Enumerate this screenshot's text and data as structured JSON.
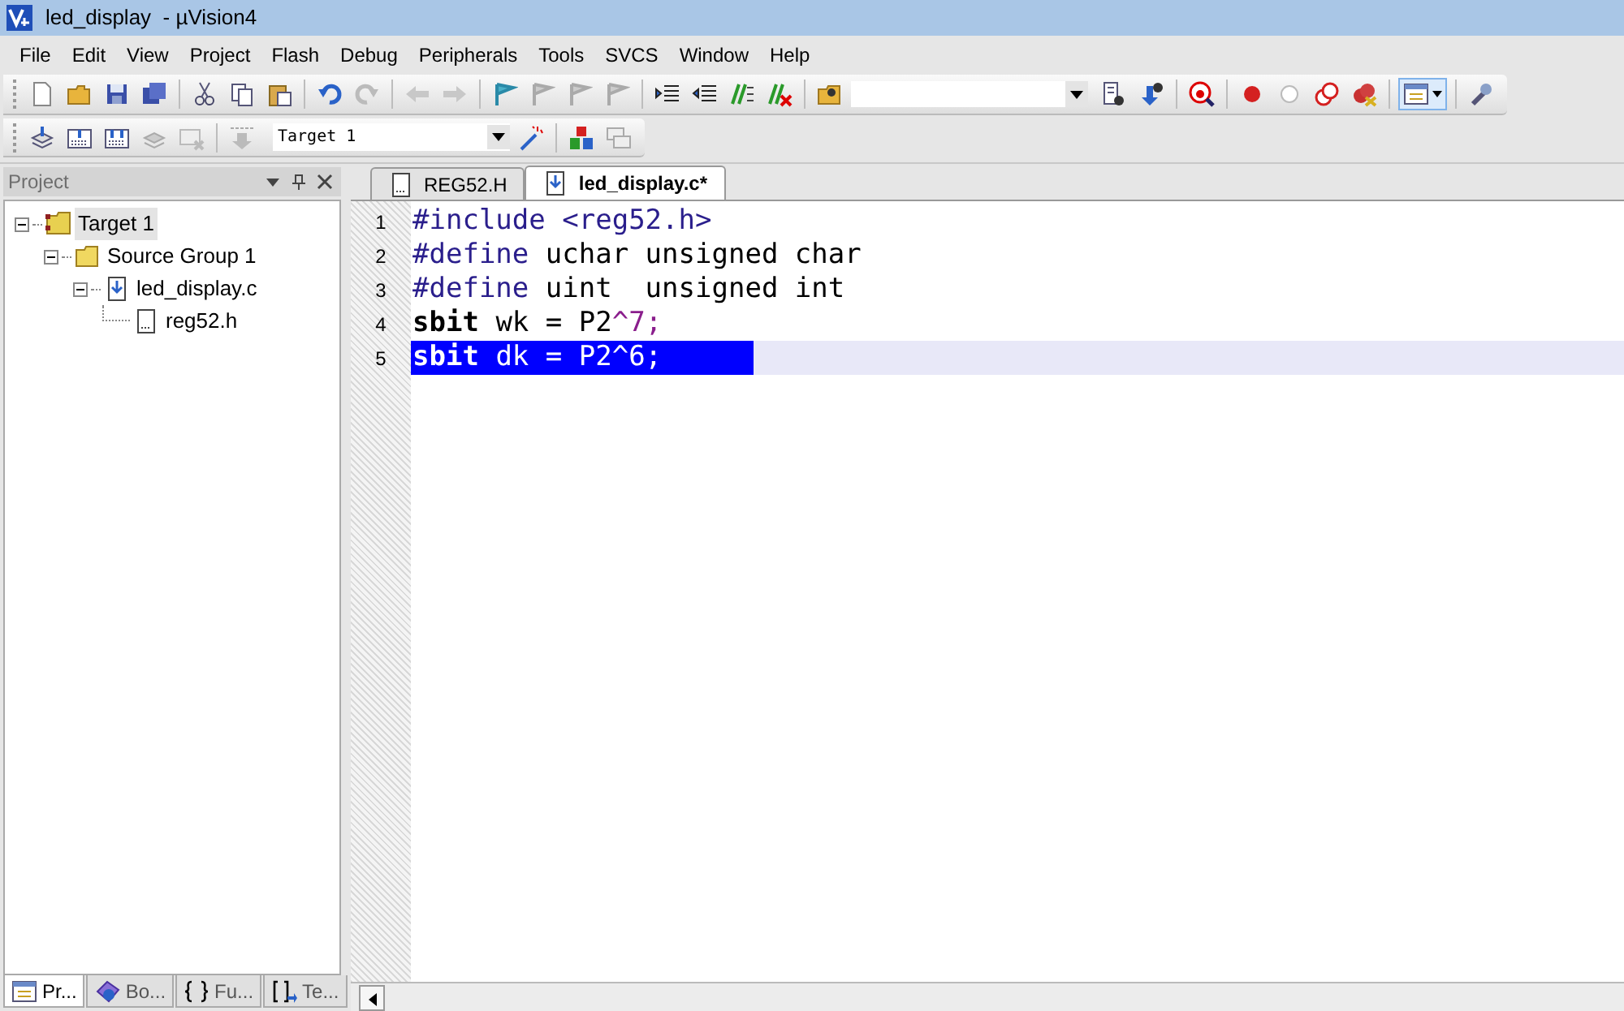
{
  "window": {
    "title": "led_display  - µVision4"
  },
  "menu": [
    "File",
    "Edit",
    "View",
    "Project",
    "Flash",
    "Debug",
    "Peripherals",
    "Tools",
    "SVCS",
    "Window",
    "Help"
  ],
  "target_select": {
    "value": "Target 1"
  },
  "project_panel": {
    "title": "Project",
    "tree": [
      {
        "label": "Target 1",
        "kind": "target",
        "selected": true,
        "expanded": true,
        "children": [
          {
            "label": "Source Group 1",
            "kind": "group",
            "selected": false,
            "expanded": true,
            "children": [
              {
                "label": "led_display.c",
                "kind": "source",
                "selected": false,
                "expanded": true,
                "children": [
                  {
                    "label": "reg52.h",
                    "kind": "header",
                    "selected": false
                  }
                ]
              }
            ]
          }
        ]
      }
    ],
    "bottom_tabs": [
      {
        "label": "Pr...",
        "kind": "project",
        "selected": true
      },
      {
        "label": "Bo...",
        "kind": "books",
        "selected": false
      },
      {
        "label": "Fu...",
        "kind": "functions",
        "selected": false
      },
      {
        "label": "Te...",
        "kind": "templates",
        "selected": false
      }
    ]
  },
  "editor": {
    "tabs": [
      {
        "label": "REG52.H",
        "selected": false
      },
      {
        "label": "led_display.c*",
        "selected": true
      }
    ],
    "lines": [
      {
        "number": "1",
        "selected": false,
        "tokens": [
          {
            "text": "#include",
            "kind": "directive"
          },
          {
            "text": " <reg52.h>",
            "kind": "directive"
          }
        ]
      },
      {
        "number": "2",
        "selected": false,
        "tokens": [
          {
            "text": "#define",
            "kind": "directive"
          },
          {
            "text": " uchar unsigned char",
            "kind": "plain"
          }
        ]
      },
      {
        "number": "3",
        "selected": false,
        "tokens": [
          {
            "text": "#define",
            "kind": "directive"
          },
          {
            "text": " uint  unsigned int",
            "kind": "plain"
          }
        ]
      },
      {
        "number": "4",
        "selected": false,
        "tokens": [
          {
            "text": "sbit",
            "kind": "keyword"
          },
          {
            "text": " wk = P2",
            "kind": "plain"
          },
          {
            "text": "^7;",
            "kind": "operator"
          }
        ]
      },
      {
        "number": "5",
        "selected": true,
        "tokens": [
          {
            "text": "sbit",
            "kind": "keyword"
          },
          {
            "text": " dk = P2^6;",
            "kind": "plain"
          }
        ]
      }
    ]
  }
}
